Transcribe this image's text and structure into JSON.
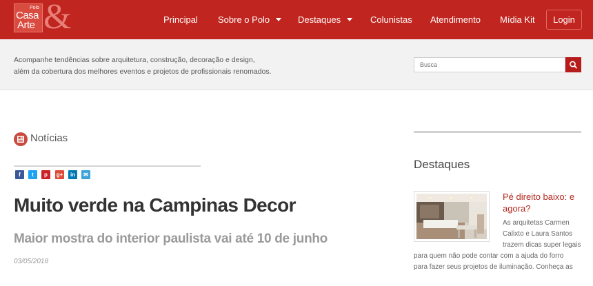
{
  "header": {
    "logo": {
      "small": "Polo",
      "line1": "Casa",
      "line2": "Arte",
      "amp": "&"
    },
    "nav": [
      {
        "label": "Principal"
      },
      {
        "label": "Sobre o Polo"
      },
      {
        "label": "Destaques"
      },
      {
        "label": "Colunistas"
      },
      {
        "label": "Atendimento"
      },
      {
        "label": "Mídia Kit"
      }
    ],
    "login_label": "Login",
    "accent_color": "#c1251f"
  },
  "subheader": {
    "tagline_line1": "Acompanhe tendências sobre arquitetura, construção, decoração e design,",
    "tagline_line2": "além da cobertura dos melhores eventos e projetos de profissionais renomados.",
    "search_placeholder": "Busca"
  },
  "main": {
    "section_title": "Notícias",
    "share_icons": [
      "facebook-icon",
      "twitter-icon",
      "pinterest-icon",
      "google-plus-icon",
      "linkedin-icon",
      "email-icon"
    ],
    "share_glyphs": {
      "facebook": "f",
      "twitter": "t",
      "pinterest": "p",
      "googleplus": "g+",
      "linkedin": "in",
      "email": "✉"
    },
    "headline": "Muito verde na Campinas Decor",
    "subheadline": "Maior mostra do interior paulista vai até 10 de junho",
    "date": "03/05/2018"
  },
  "sidebar": {
    "title": "Destaques",
    "card": {
      "title": "Pé direito baixo: e agora?",
      "text_line1": "As arquitetas Carmen",
      "text_line2": "Calixto e Laura Santos",
      "text_line3": "trazem dicas super legais",
      "text_line4": "para quem não pode contar com a ajuda do forro",
      "text_line5": "para fazer seus projetos de iluminação. Conheça as"
    }
  }
}
